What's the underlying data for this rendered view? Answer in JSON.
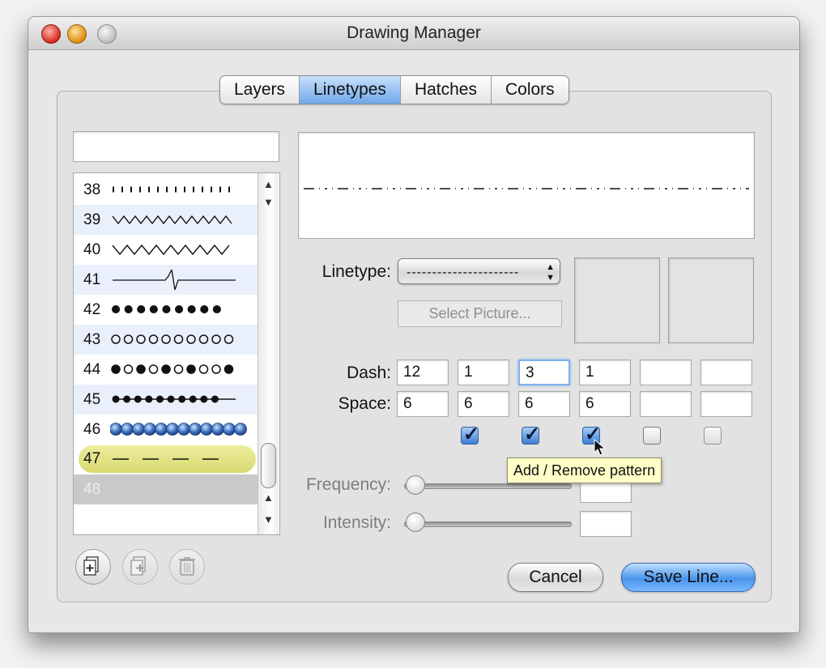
{
  "window": {
    "title": "Drawing Manager",
    "buttons": [
      "close-button",
      "minimize-button",
      "zoom-button"
    ]
  },
  "tabs": [
    {
      "label": "Layers",
      "selected": false
    },
    {
      "label": "Linetypes",
      "selected": true
    },
    {
      "label": "Hatches",
      "selected": false
    },
    {
      "label": "Colors",
      "selected": false
    }
  ],
  "search": {
    "value": ""
  },
  "linetype_list": {
    "items": [
      {
        "number": "38",
        "pattern": "dotted-fine",
        "state": "normal"
      },
      {
        "number": "39",
        "pattern": "zigzag-dense",
        "state": "normal"
      },
      {
        "number": "40",
        "pattern": "zigzag",
        "state": "normal"
      },
      {
        "number": "41",
        "pattern": "pulse",
        "state": "normal"
      },
      {
        "number": "42",
        "pattern": "filled-dots",
        "state": "normal"
      },
      {
        "number": "43",
        "pattern": "hollow-dots",
        "state": "normal"
      },
      {
        "number": "44",
        "pattern": "alternating-dots",
        "state": "normal"
      },
      {
        "number": "45",
        "pattern": "dots-on-line",
        "state": "normal"
      },
      {
        "number": "46",
        "pattern": "blue-beads",
        "state": "normal"
      },
      {
        "number": "47",
        "pattern": "long-dash",
        "state": "highlighted"
      },
      {
        "number": "48",
        "pattern": "",
        "state": "selected"
      }
    ]
  },
  "linetype": {
    "label": "Linetype:",
    "selected_value": "----------------------"
  },
  "select_picture_label": "Select Picture...",
  "dash": {
    "label": "Dash:",
    "values": [
      "12",
      "1",
      "3",
      "1",
      "",
      ""
    ]
  },
  "space": {
    "label": "Space:",
    "values": [
      "6",
      "6",
      "6",
      "6",
      "",
      ""
    ]
  },
  "pattern_checkboxes": [
    true,
    true,
    true,
    false,
    false
  ],
  "tooltip": "Add / Remove pattern",
  "frequency": {
    "label": "Frequency:",
    "value": 0,
    "field": ""
  },
  "intensity": {
    "label": "Intensity:",
    "value": 0,
    "field": ""
  },
  "buttons": {
    "cancel": "Cancel",
    "save": "Save Line..."
  },
  "list_actions": [
    "add-linetype-icon",
    "duplicate-linetype-icon",
    "delete-linetype-icon"
  ],
  "colors": {
    "accent": "#4a95ec",
    "highlight": "#e4e58a",
    "selected_row": "#c9c9c9"
  }
}
